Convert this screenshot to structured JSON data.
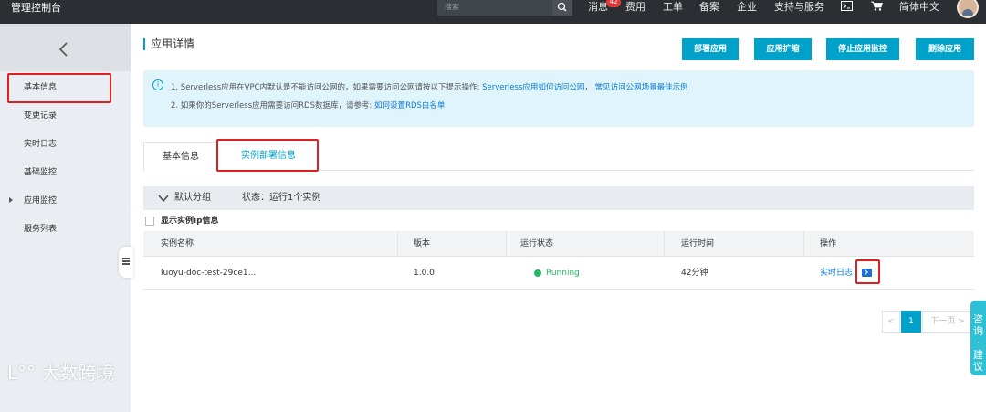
{
  "topbar": {
    "brand": "管理控制台",
    "search_placeholder": "搜索",
    "nav": {
      "messages": "消息",
      "messages_count": "42",
      "fees": "费用",
      "tickets": "工单",
      "filing": "备案",
      "enterprise": "企业",
      "support": "支持与服务",
      "language": "简体中文"
    }
  },
  "sidebar": {
    "items": [
      {
        "label": "基本信息"
      },
      {
        "label": "变更记录"
      },
      {
        "label": "实时日志"
      },
      {
        "label": "基础监控"
      },
      {
        "label": "应用监控"
      },
      {
        "label": "服务列表"
      }
    ],
    "watermark": "大数跨境"
  },
  "main": {
    "title": "应用详情",
    "buttons": {
      "deploy": "部署应用",
      "scale": "应用扩缩",
      "stop_monitor": "停止应用监控",
      "delete": "删除应用"
    },
    "notice": {
      "line1_prefix": "1. Serverless应用在VPC内默认是不能访问公网的，如果需要访问公网请按以下提示操作:",
      "line1_link1": "Serverless应用如何访问公网",
      "line1_link2": "常见访问公网场景最佳示例",
      "line2_prefix": "2. 如果你的Serverless应用需要访问RDS数据库，请参考:",
      "line2_link": "如何设置RDS白名单"
    },
    "tabs": {
      "basic": "基本信息",
      "instances": "实例部署信息"
    },
    "group": {
      "name": "默认分组",
      "status": "状态：运行1个实例"
    },
    "show_ip_label": "显示实例ip信息",
    "table": {
      "headers": {
        "name": "实例名称",
        "version": "版本",
        "status": "运行状态",
        "uptime": "运行时间",
        "ops": "操作"
      },
      "rows": [
        {
          "name": "luoyu-doc-test-29ce1...",
          "version": "1.0.0",
          "status": "Running",
          "uptime": "42分钟",
          "op_log": "实时日志"
        }
      ]
    },
    "pager": {
      "prev": "<",
      "current": "1",
      "next": "下一页 >"
    }
  },
  "consult": {
    "l1": "咨",
    "l2": "询",
    "l3": "·",
    "l4": "建",
    "l5": "议"
  },
  "colors": {
    "accent": "#00a2ca",
    "running": "#25b864",
    "highlight_box": "#e02020"
  }
}
